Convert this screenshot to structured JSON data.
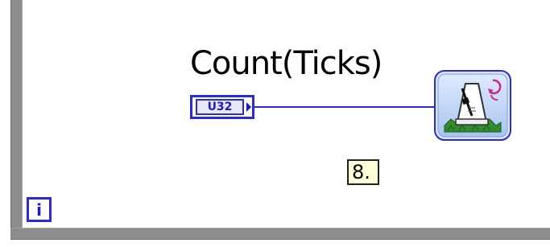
{
  "block_diagram": {
    "label": "Count(Ticks)",
    "control_terminal": {
      "type_label": "U32"
    },
    "constant": {
      "value": "8."
    },
    "iteration_terminal": {
      "label": "i"
    },
    "function_icon": "tick-count-metronome-icon"
  },
  "colors": {
    "wire": "#2a2ad8",
    "terminal_border": "#2a2ad8",
    "loop_border": "#8c8c8c",
    "constant_bg": "#ffffd8"
  }
}
